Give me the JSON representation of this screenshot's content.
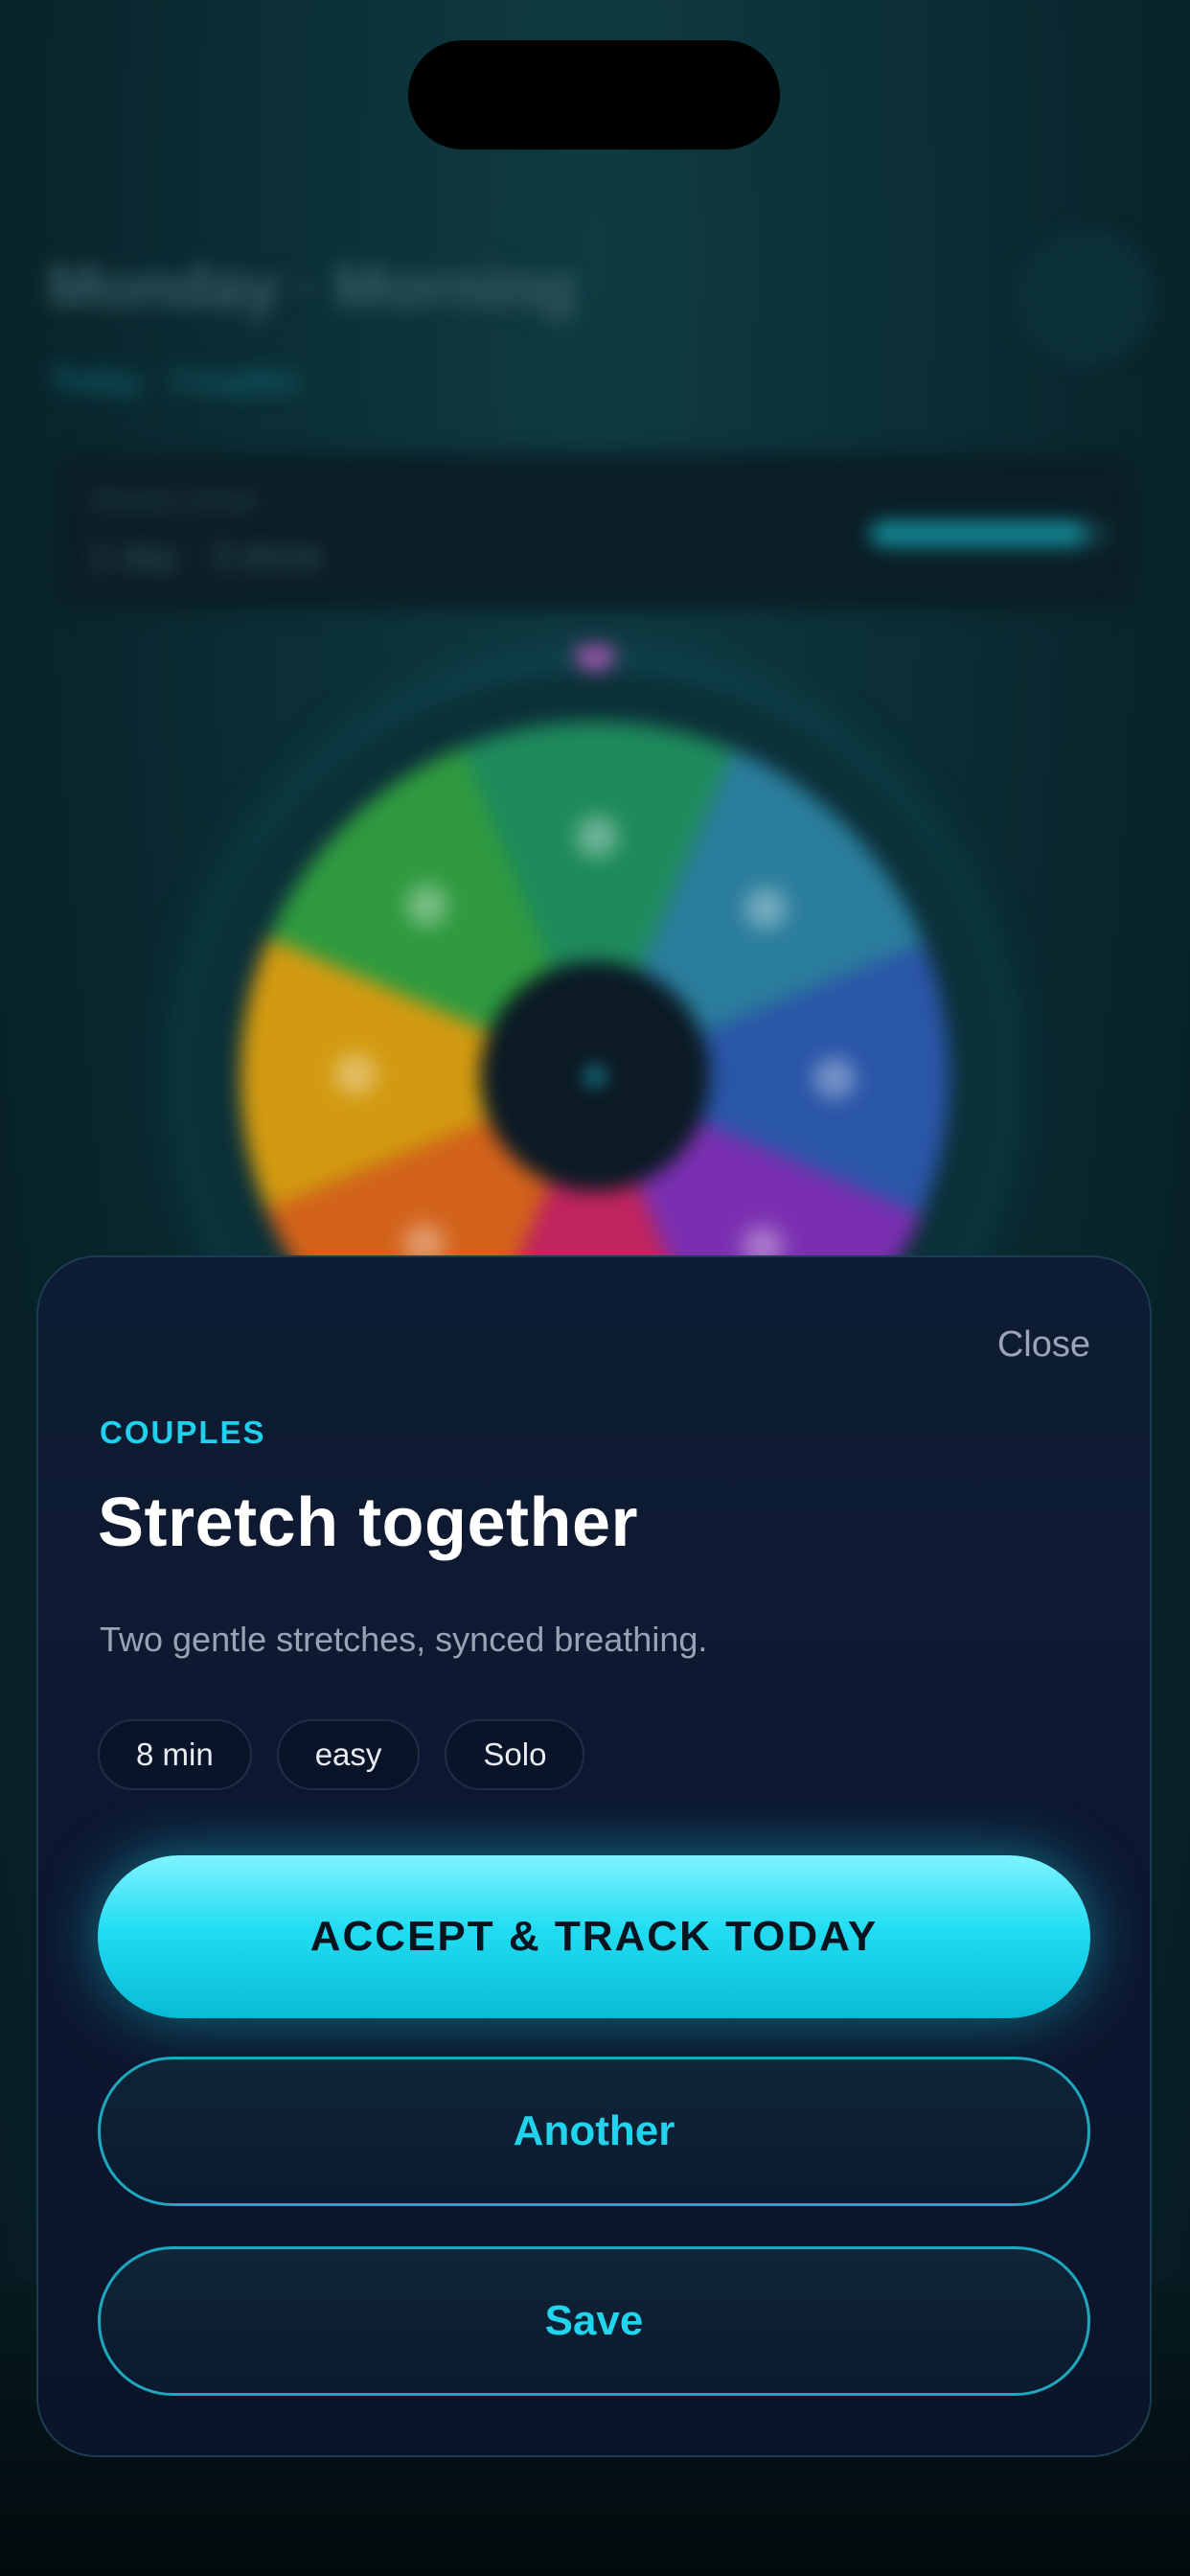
{
  "background": {
    "title": "Monday · Morning",
    "subtitle": "Today · Couples",
    "progress": {
      "label": "Weekly streak",
      "value": "1 day · 3 done",
      "fill": 0.9
    },
    "wheel_colors": [
      "#1e8a5c",
      "#2a7d9c",
      "#2a56a8",
      "#7a2fb0",
      "#c0245e",
      "#d2621a",
      "#d29a10",
      "#2f9a3f"
    ],
    "accent": "#21d0ec"
  },
  "sheet": {
    "close_label": "Close",
    "category": "COUPLES",
    "title": "Stretch together",
    "description": "Two gentle stretches, synced breathing.",
    "tags": [
      "8 min",
      "easy",
      "Solo"
    ],
    "primary_button": "ACCEPT & TRACK TODAY",
    "another_button": "Another",
    "save_button": "Save"
  }
}
